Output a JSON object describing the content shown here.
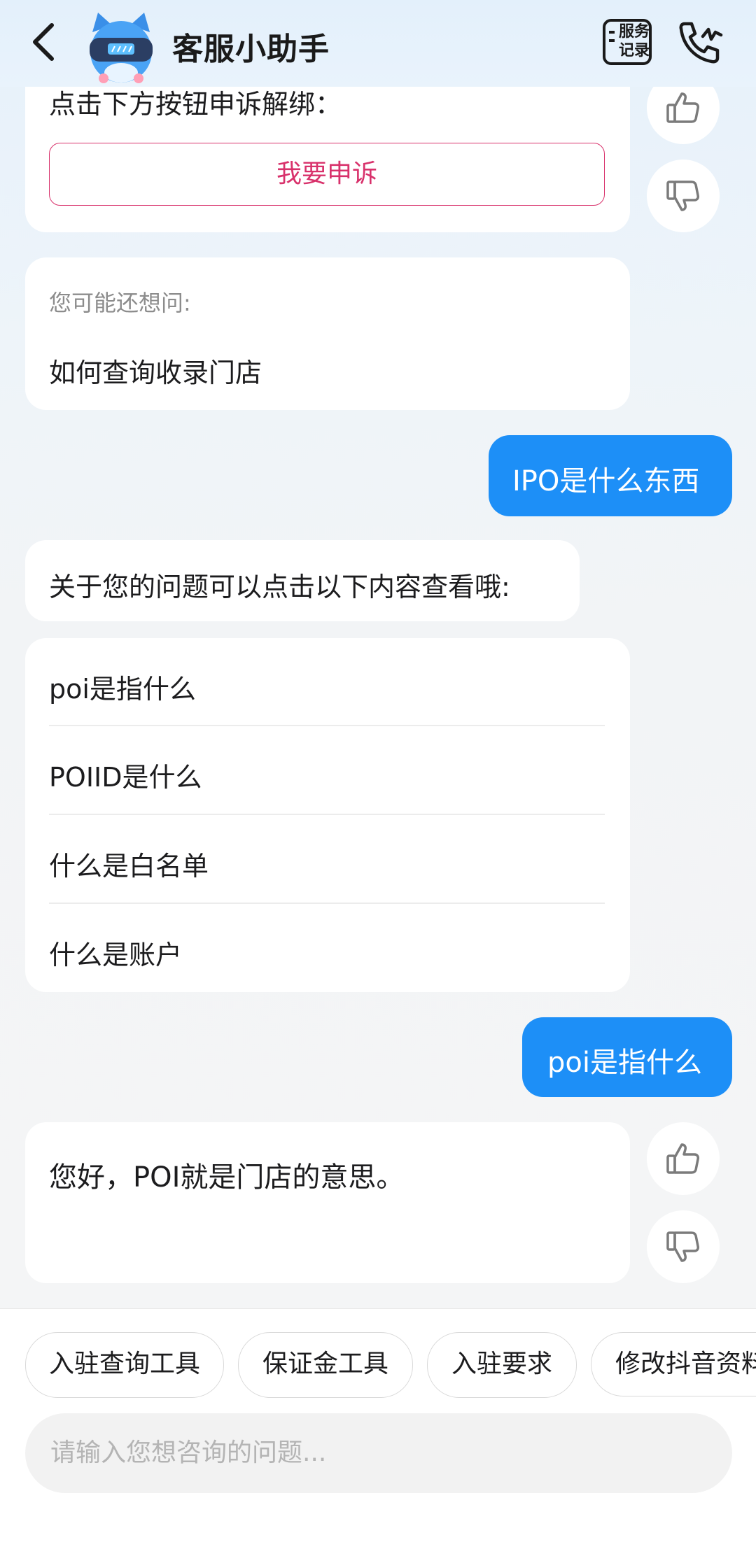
{
  "header": {
    "title": "客服小助手",
    "service_record_line1": "服务",
    "service_record_line2": "记录"
  },
  "messages": {
    "top_card_text": "点击下方按钮申诉解绑：",
    "appeal_button": "我要申诉",
    "suggest_label": "您可能还想问:",
    "suggest_item": "如何查询收录门店",
    "user_msg_1": "IPO是什么东西",
    "bot_reply_1": "关于您的问题可以点击以下内容查看哦:",
    "faq_items": [
      "poi是指什么",
      "POIID是什么",
      "什么是白名单",
      "什么是账户"
    ],
    "user_msg_2": "poi是指什么",
    "bot_reply_2": "您好，POI就是门店的意思。"
  },
  "quick_actions": [
    "入驻查询工具",
    "保证金工具",
    "入驻要求",
    "修改抖音资料"
  ],
  "input": {
    "placeholder": "请输入您想咨询的问题..."
  },
  "colors": {
    "accent": "#1d8ff7",
    "appeal": "#d8316b",
    "page_bg": "#f4f5f6"
  },
  "icons": {
    "back": "chevron-left-icon",
    "avatar": "robot-cat-avatar",
    "service_record": "document-icon",
    "phone": "phone-icon",
    "thumbs_up": "thumbs-up-icon",
    "thumbs_down": "thumbs-down-icon"
  }
}
